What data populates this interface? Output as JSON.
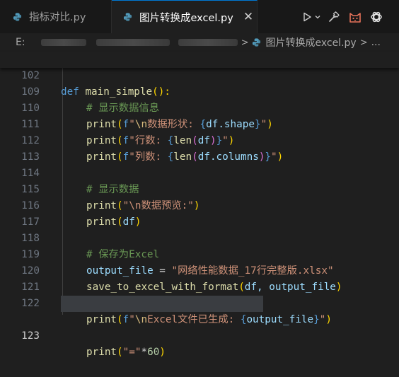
{
  "tabs": [
    {
      "label": "指标对比.py",
      "active": false
    },
    {
      "label": "图片转换成excel.py",
      "active": true
    }
  ],
  "tab_close_glyph": "✕",
  "actions": [
    "run-icon",
    "chevron-down-icon",
    "hammer-icon",
    "cat-icon",
    "openai-icon"
  ],
  "breadcrumb": {
    "drive": "E:",
    "file": "图片转换成excel.py",
    "sep": ">",
    "tail": "..."
  },
  "editor": {
    "sticky_line": {
      "num": "102",
      "def": "def",
      "name": "main_simple",
      "paren": "():"
    },
    "lines": [
      {
        "num": "109",
        "comment": "# 显示数据信息"
      },
      {
        "num": "110",
        "fn": "print",
        "fp": "f",
        "q1": "\"",
        "esc": "\\n",
        "text": "数据形状: ",
        "lb": "{",
        "expr": "df.shape",
        "rb": "}",
        "q2": "\""
      },
      {
        "num": "111",
        "fn": "print",
        "fp": "f",
        "q1": "\"",
        "text": "行数: ",
        "lb": "{",
        "inner_fn": "len",
        "arg": "df",
        "rb": "}",
        "q2": "\""
      },
      {
        "num": "112",
        "fn": "print",
        "fp": "f",
        "q1": "\"",
        "text": "列数: ",
        "lb": "{",
        "inner_fn": "len",
        "arg": "df.columns",
        "rb": "}",
        "q2": "\""
      },
      {
        "num": "113"
      },
      {
        "num": "114",
        "comment": "# 显示数据"
      },
      {
        "num": "115",
        "fn": "print",
        "str": "\"\\n数据预览:\""
      },
      {
        "num": "116",
        "fn": "print",
        "arg": "df"
      },
      {
        "num": "117"
      },
      {
        "num": "118",
        "comment": "# 保存为Excel"
      },
      {
        "num": "119",
        "var": "output_file",
        "op": " = ",
        "str": "\"网络性能数据_17行完整版.xlsx\""
      },
      {
        "num": "120",
        "fn": "save_to_excel_with_format",
        "args": "df, output_file"
      },
      {
        "num": "121"
      },
      {
        "num": "122",
        "fn": "print",
        "fp": "f",
        "q1": "\"",
        "esc": "\\n",
        "text": "Excel文件已生成: ",
        "lb": "{",
        "expr": "output_file",
        "rb": "}",
        "q2": "\""
      },
      {
        "num": "123",
        "fn": "print",
        "str": "\"=\"",
        "op": "*",
        "num_lit": "60"
      }
    ]
  },
  "colors": {
    "background": "#1f1f1f",
    "keyword": "#569cd6",
    "function": "#dcdcaa",
    "string": "#ce9178",
    "comment": "#6a9955",
    "variable": "#9cdcfe",
    "accent": "#0078d4"
  }
}
